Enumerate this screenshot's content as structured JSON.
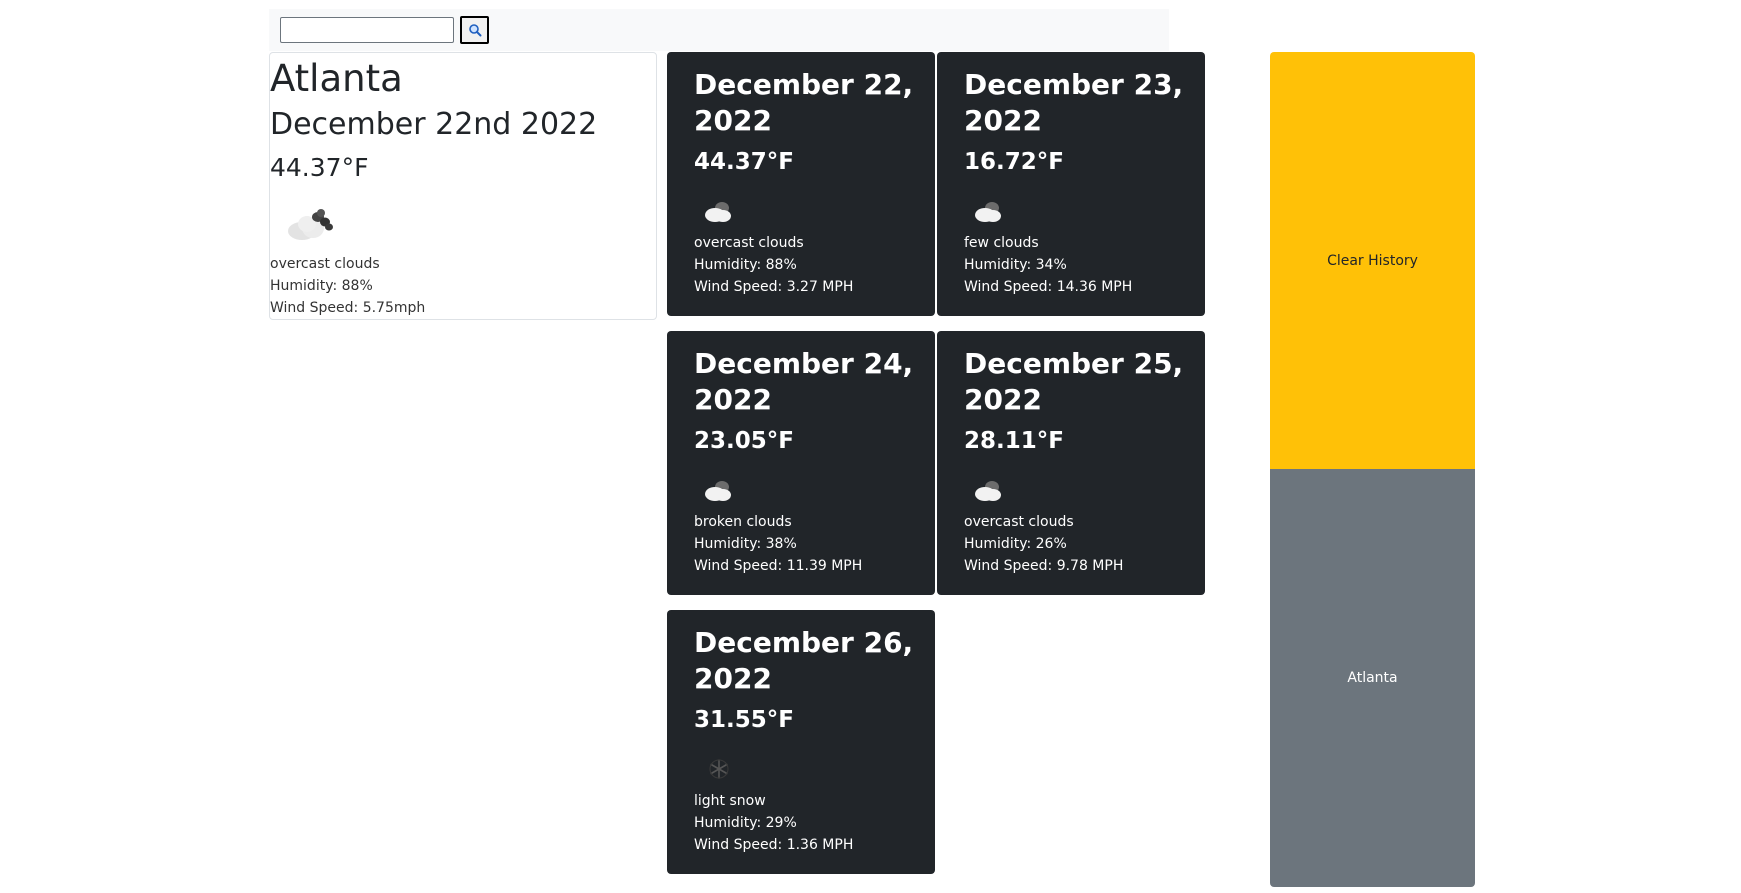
{
  "search": {
    "value": "",
    "button_icon": "search-icon"
  },
  "current": {
    "city": "Atlanta",
    "date": "December 22nd 2022",
    "temp": "44.37°F",
    "icon": "overcast-clouds-icon",
    "description": "overcast clouds",
    "humidity": "Humidity: 88%",
    "wind": "Wind Speed: 5.75mph"
  },
  "forecast": [
    {
      "date": "December 22, 2022",
      "temp": "44.37°F",
      "icon": "cloud-icon",
      "description": "overcast clouds",
      "humidity": "Humidity: 88%",
      "wind": "Wind Speed: 3.27 MPH"
    },
    {
      "date": "December 23, 2022",
      "temp": "16.72°F",
      "icon": "cloud-icon",
      "description": "few clouds",
      "humidity": "Humidity: 34%",
      "wind": "Wind Speed: 14.36 MPH"
    },
    {
      "date": "December 24, 2022",
      "temp": "23.05°F",
      "icon": "cloud-icon",
      "description": "broken clouds",
      "humidity": "Humidity: 38%",
      "wind": "Wind Speed: 11.39 MPH"
    },
    {
      "date": "December 25, 2022",
      "temp": "28.11°F",
      "icon": "cloud-icon",
      "description": "overcast clouds",
      "humidity": "Humidity: 26%",
      "wind": "Wind Speed: 9.78 MPH"
    },
    {
      "date": "December 26, 2022",
      "temp": "31.55°F",
      "icon": "snow-icon",
      "description": "light snow",
      "humidity": "Humidity: 29%",
      "wind": "Wind Speed: 1.36 MPH"
    }
  ],
  "history": {
    "clear_label": "Clear History",
    "items": [
      "Atlanta"
    ]
  },
  "colors": {
    "card_bg": "#212529",
    "clear_bg": "#ffc107",
    "history_bg": "#6c757d"
  }
}
